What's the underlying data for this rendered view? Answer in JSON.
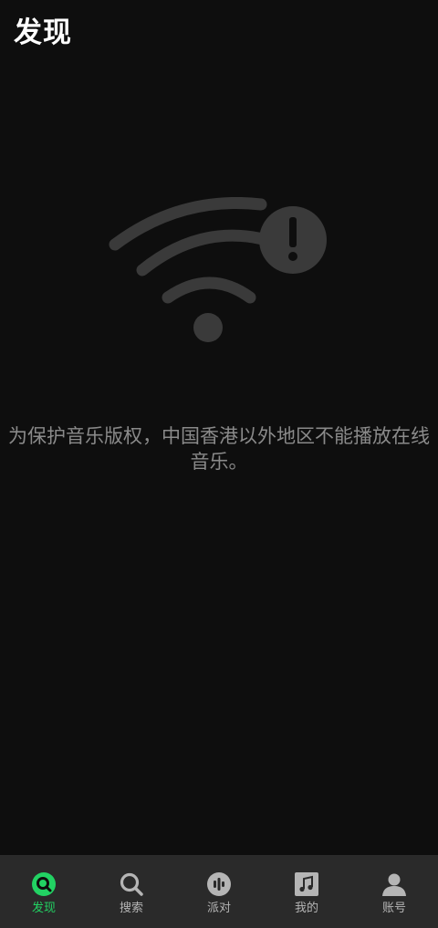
{
  "header": {
    "title": "发现"
  },
  "content": {
    "graphic": "wifi-off-warning-icon",
    "message": "为保护音乐版权，中国香港以外地区不能播放在线\n音乐。"
  },
  "tabbar": {
    "active_color": "#22d263",
    "inactive_color": "#b5b5b5",
    "tabs": [
      {
        "label": "发现",
        "icon": "discover-icon",
        "active": true
      },
      {
        "label": "搜索",
        "icon": "search-icon",
        "active": false
      },
      {
        "label": "派对",
        "icon": "party-icon",
        "active": false
      },
      {
        "label": "我的",
        "icon": "music-note-icon",
        "active": false
      },
      {
        "label": "账号",
        "icon": "person-icon",
        "active": false
      }
    ]
  }
}
